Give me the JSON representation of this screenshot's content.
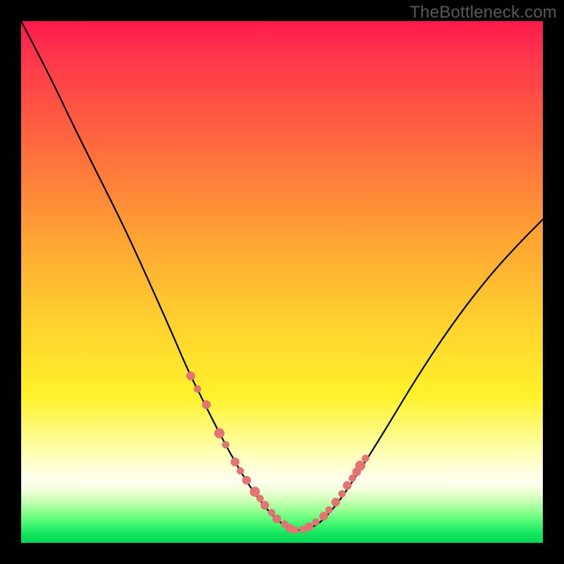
{
  "attribution": "TheBottleneck.com",
  "colors": {
    "page_bg": "#000000",
    "attribution_text": "#595959",
    "curve_stroke": "#000000",
    "bead_fill": "#e57373",
    "bead_stroke": "#d46a6a",
    "gradient_top": "#ff1a4d",
    "gradient_mid": "#ffd22e",
    "gradient_bottom": "#00d856"
  },
  "chart_data": {
    "type": "line",
    "title": "",
    "xlabel": "",
    "ylabel": "",
    "xlim": [
      0,
      100
    ],
    "ylim": [
      0,
      100
    ],
    "series": [
      {
        "name": "bottleneck-curve",
        "x": [
          0,
          5,
          10,
          15,
          20,
          25,
          29,
          32,
          35,
          38,
          41,
          44,
          47,
          50,
          53,
          56,
          58,
          61,
          65,
          70,
          76,
          83,
          90,
          96,
          100
        ],
        "y": [
          100,
          90.5,
          80,
          70,
          60,
          49,
          40,
          33,
          27,
          21,
          15.5,
          10.5,
          6.5,
          3.5,
          2.2,
          3.0,
          4.5,
          8,
          14,
          22,
          32,
          42.5,
          51.5,
          58,
          62
        ]
      }
    ],
    "beads": {
      "name": "highlight-points",
      "x": [
        32.5,
        33.8,
        35.5,
        38.0,
        39.2,
        41.0,
        42.0,
        43.2,
        44.8,
        45.8,
        46.7,
        48.0,
        49.0,
        50.5,
        51.5,
        52.5,
        54.0,
        55.2,
        56.5,
        58.0,
        59.0,
        60.3,
        61.5,
        62.5,
        63.5,
        64.3,
        65.0,
        66.0
      ],
      "y": [
        32.0,
        29.5,
        26.5,
        21.0,
        18.8,
        15.5,
        13.8,
        12.0,
        9.8,
        8.5,
        7.2,
        5.8,
        4.6,
        3.6,
        2.8,
        2.4,
        2.6,
        3.1,
        4.0,
        5.1,
        6.3,
        7.8,
        9.4,
        11.0,
        12.4,
        13.6,
        14.8,
        16.2
      ],
      "r": [
        6,
        5,
        6,
        7,
        5,
        6,
        5,
        6,
        7,
        5,
        6,
        5,
        6,
        5,
        6,
        5,
        5,
        6,
        5,
        6,
        5,
        6,
        5,
        6,
        5,
        6,
        7,
        5
      ]
    },
    "gradient_stops_pct_to_color": [
      [
        0,
        "#ff1a4d"
      ],
      [
        8,
        "#ff3a4a"
      ],
      [
        24,
        "#ff6a3e"
      ],
      [
        42,
        "#ffa533"
      ],
      [
        58,
        "#ffd22e"
      ],
      [
        72,
        "#fff22a"
      ],
      [
        82.5,
        "#ffffb0"
      ],
      [
        86.5,
        "#ffffe0"
      ],
      [
        88.5,
        "#fffff0"
      ],
      [
        90.5,
        "#e8ffd0"
      ],
      [
        92,
        "#c7ffb4"
      ],
      [
        93.5,
        "#9eff98"
      ],
      [
        95,
        "#6fff82"
      ],
      [
        96.5,
        "#40f770"
      ],
      [
        98,
        "#18e860"
      ],
      [
        100,
        "#00d856"
      ]
    ]
  }
}
